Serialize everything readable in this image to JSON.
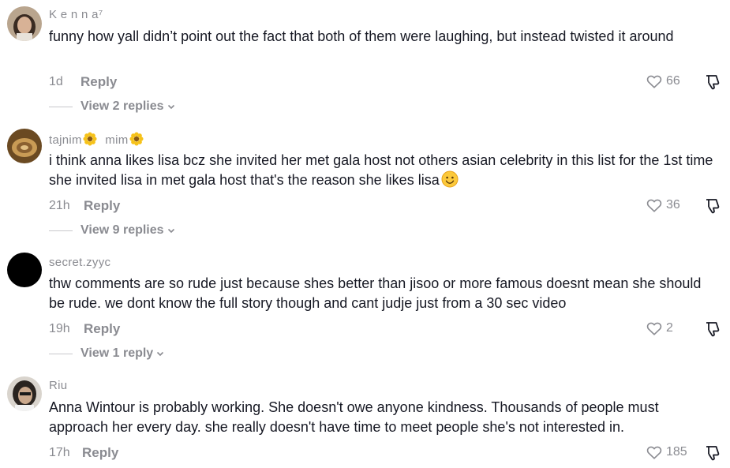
{
  "comments": [
    {
      "username": "K e n n a⁷",
      "text": "funny how yall didn’t point out the fact that both of them were laughing, but instead twisted it around",
      "time": "1d",
      "reply_label": "Reply",
      "likes": "66",
      "view_replies": "View 2 replies"
    },
    {
      "username_part1": "tajnim",
      "username_part2": "mim",
      "text": "i think anna likes lisa bcz she invited her met gala host not others asian celebrity in this list for the 1st time she invited lisa in met gala host that's the reason she likes lisa",
      "time": "21h",
      "reply_label": "Reply",
      "likes": "36",
      "view_replies": "View 9 replies"
    },
    {
      "username": "secret.zyyc",
      "text": "thw comments are so rude just because shes better than jisoo or more famous doesnt mean she should be rude. we dont know the full story though and cant judje just from a 30 sec video",
      "time": "19h",
      "reply_label": "Reply",
      "likes": "2",
      "view_replies": "View 1 reply"
    },
    {
      "username": "Riu",
      "text": "Anna Wintour is probably working. She doesn't owe anyone kindness. Thousands of people must approach her every day. she really doesn't have time to meet people she's not interested in.",
      "time": "17h",
      "reply_label": "Reply",
      "likes": "185"
    }
  ],
  "icons": {
    "like": "heart-outline-icon",
    "dislike": "thumbs-down-outline-icon",
    "chevron": "chevron-down-icon",
    "flower": "sunflower-emoji-icon",
    "smiley": "smiling-face-emoji-icon"
  },
  "colors": {
    "text": "#161823",
    "muted": "#8a8b91"
  }
}
